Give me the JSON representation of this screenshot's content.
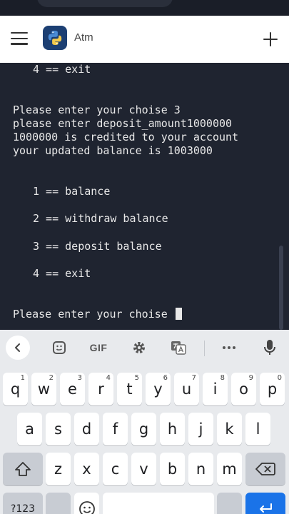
{
  "app": {
    "title": "Atm"
  },
  "terminal": {
    "lines": [
      "4 == exit",
      "Please enter your choise 3",
      "please enter deposit_amount1000000",
      "1000000 is credited to your account",
      "your updated balance is 1003000",
      "1 == balance",
      "2 == withdraw balance",
      "3 == deposit balance",
      "4 == exit",
      "Please enter your choise "
    ]
  },
  "keyboard": {
    "toolbar": {
      "gif_label": "GIF"
    },
    "row1": [
      {
        "key": "q",
        "hint": "1"
      },
      {
        "key": "w",
        "hint": "2"
      },
      {
        "key": "e",
        "hint": "3"
      },
      {
        "key": "r",
        "hint": "4"
      },
      {
        "key": "t",
        "hint": "5"
      },
      {
        "key": "y",
        "hint": "6"
      },
      {
        "key": "u",
        "hint": "7"
      },
      {
        "key": "i",
        "hint": "8"
      },
      {
        "key": "o",
        "hint": "9"
      },
      {
        "key": "p",
        "hint": "0"
      }
    ],
    "row2": [
      "a",
      "s",
      "d",
      "f",
      "g",
      "h",
      "j",
      "k",
      "l"
    ],
    "row3": [
      "z",
      "x",
      "c",
      "v",
      "b",
      "n",
      "m"
    ],
    "symbols_label": "?123"
  },
  "icons": {
    "menu": "hamburger-menu-icon",
    "add": "plus-icon",
    "back": "chevron-left-icon",
    "sticker": "sticker-icon",
    "settings": "gear-icon",
    "translate": "translate-icon",
    "more": "more-horizontal-icon",
    "mic": "microphone-icon",
    "shift": "shift-icon",
    "backspace": "backspace-icon",
    "emoji": "emoji-icon",
    "enter": "enter-icon"
  }
}
